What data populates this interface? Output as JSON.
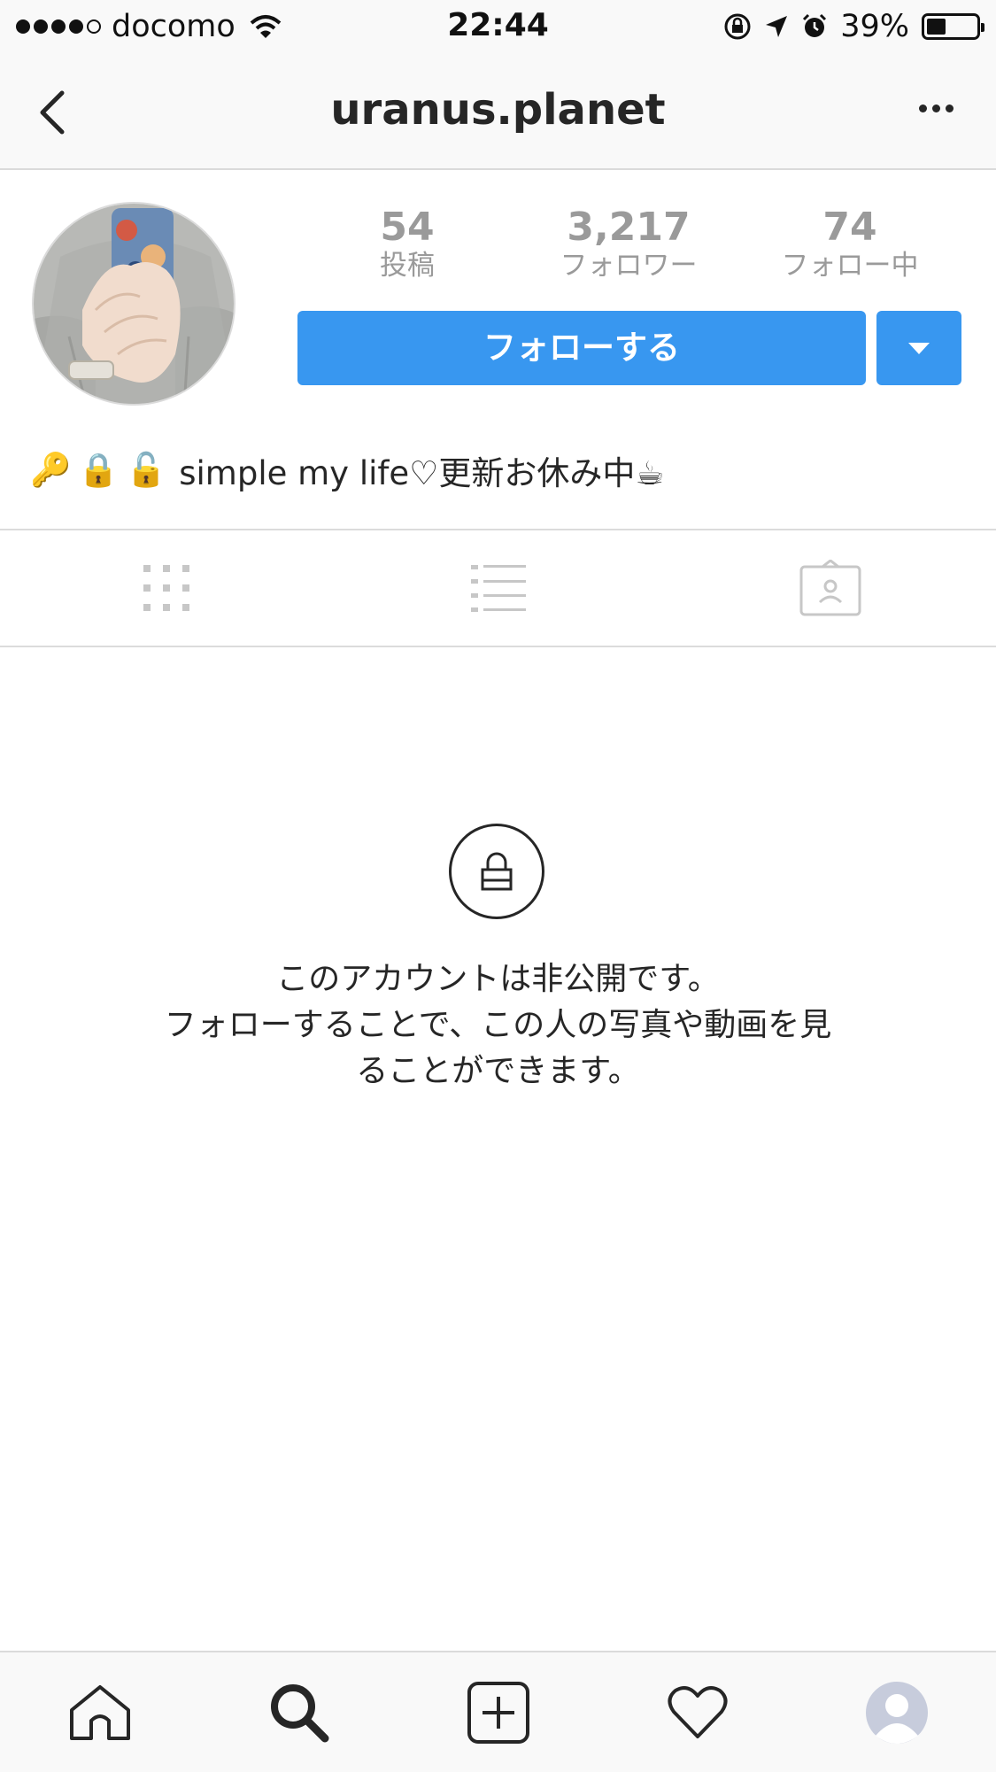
{
  "status_bar": {
    "carrier": "docomo",
    "time": "22:44",
    "battery": "39%",
    "battery_level": 0.39,
    "signal_bars": 4,
    "signal_total": 5
  },
  "nav": {
    "title": "uranus.planet",
    "back_icon": "chevron-left-icon",
    "more_icon": "more-horizontal-icon"
  },
  "profile": {
    "stats": [
      {
        "value": "54",
        "label": "投稿"
      },
      {
        "value": "3,217",
        "label": "フォロワー"
      },
      {
        "value": "74",
        "label": "フォロー中"
      }
    ],
    "follow_label": "フォローする",
    "bio_emojis": [
      "🔑",
      "🔒",
      "🔓"
    ],
    "bio_text": "simple my life♡更新お休み中☕",
    "accent_color": "#3897f0"
  },
  "tabs": [
    {
      "icon": "grid-icon"
    },
    {
      "icon": "list-icon"
    },
    {
      "icon": "tagged-icon"
    }
  ],
  "private": {
    "line1": "このアカウントは非公開です。",
    "line2": "フォローすることで、この人の写真や動画を見",
    "line3": "ることができます。"
  },
  "bottom_nav": [
    {
      "icon": "home-icon"
    },
    {
      "icon": "search-icon",
      "active": true
    },
    {
      "icon": "add-post-icon"
    },
    {
      "icon": "heart-icon"
    },
    {
      "icon": "profile-icon"
    }
  ]
}
